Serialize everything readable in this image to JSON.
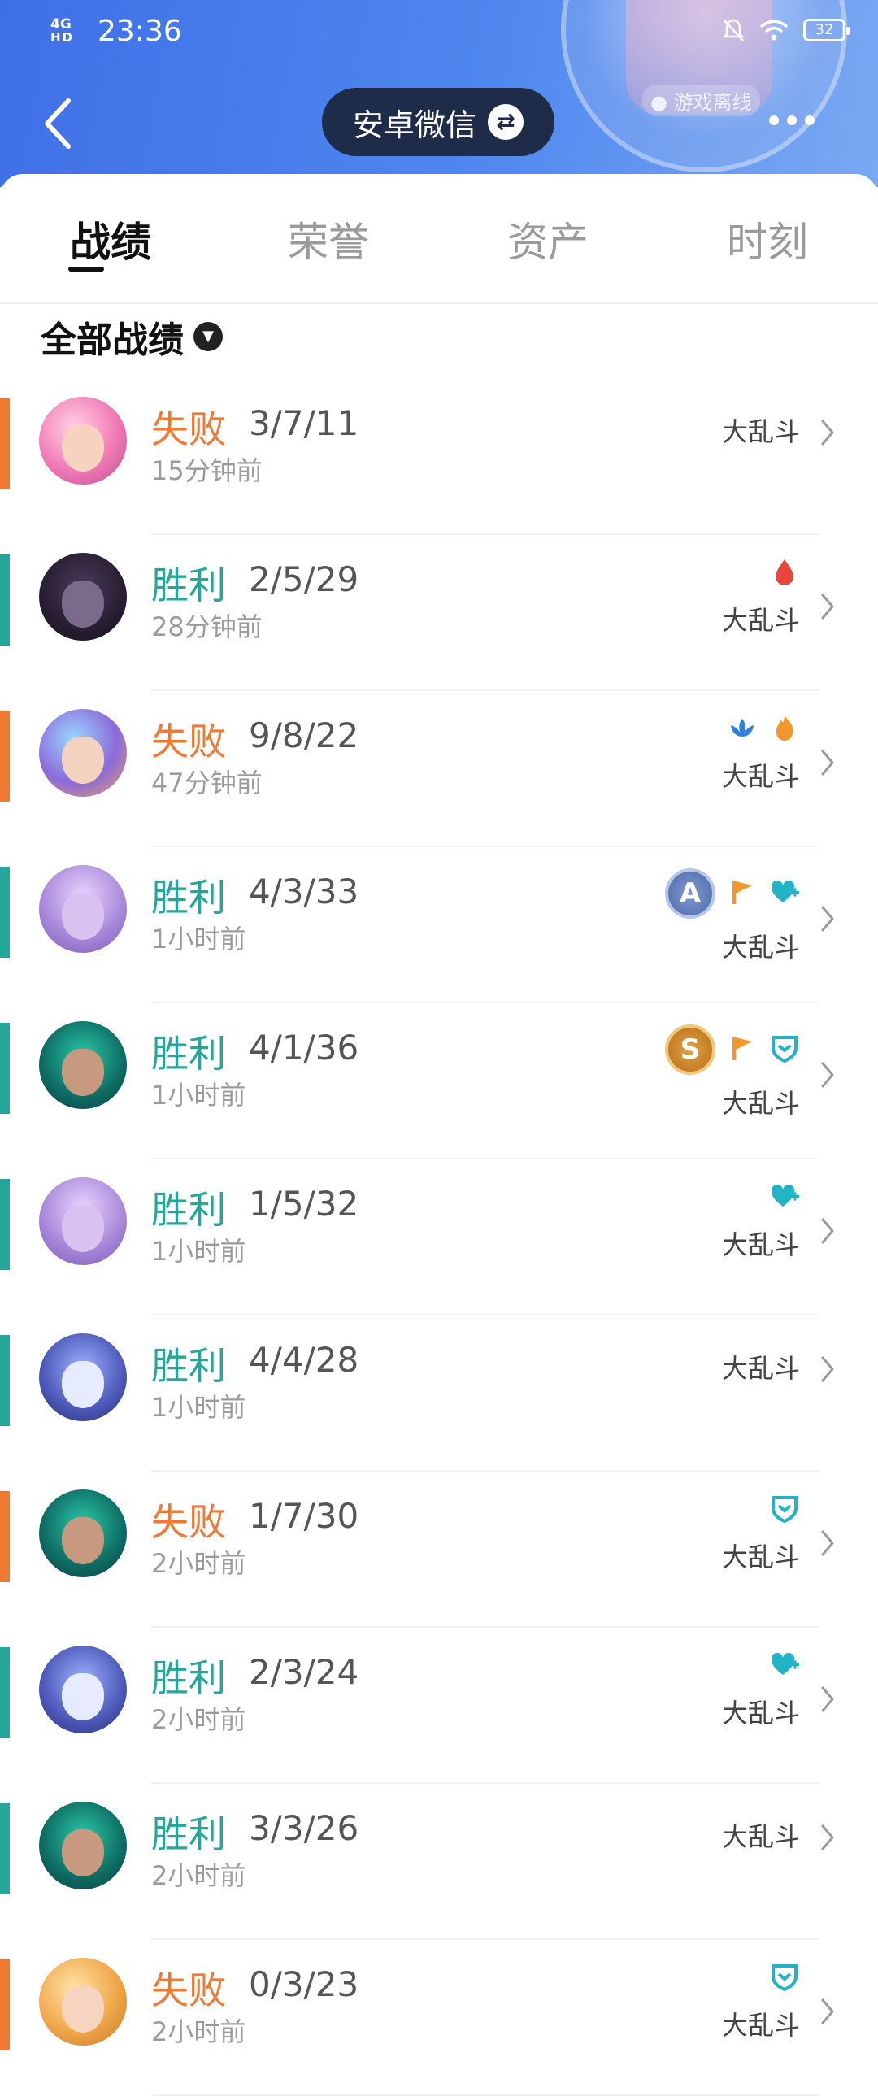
{
  "status_bar": {
    "network": "4G",
    "network_sub": "HD",
    "time": "23:36",
    "battery": "32"
  },
  "header": {
    "account_label": "安卓微信",
    "offline_label": "游戏离线"
  },
  "tabs": [
    {
      "label": "战绩"
    },
    {
      "label": "荣誉"
    },
    {
      "label": "资产"
    },
    {
      "label": "时刻"
    }
  ],
  "filter": {
    "label": "全部战绩"
  },
  "colors": {
    "loss": "#f07a34",
    "win": "#26a69a",
    "accent_header": "#4a7cea"
  },
  "matches": [
    {
      "result": "失败",
      "kda": "3/7/11",
      "time": "15分钟前",
      "mode": "大乱斗",
      "avatar": "pink-hair-champion",
      "badges": []
    },
    {
      "result": "胜利",
      "kda": "2/5/29",
      "time": "28分钟前",
      "mode": "大乱斗",
      "avatar": "dark-purple-champion",
      "badges": [
        "blood-drop-icon"
      ]
    },
    {
      "result": "失败",
      "kda": "9/8/22",
      "time": "47分钟前",
      "mode": "大乱斗",
      "avatar": "pastel-hair-champion",
      "badges": [
        "lotus-icon",
        "flame-icon"
      ]
    },
    {
      "result": "胜利",
      "kda": "4/3/33",
      "time": "1小时前",
      "mode": "大乱斗",
      "avatar": "violet-robed-champion",
      "badges": [
        "A",
        "flag-icon",
        "heart-plus-icon"
      ]
    },
    {
      "result": "胜利",
      "kda": "4/1/36",
      "time": "1小时前",
      "mode": "大乱斗",
      "avatar": "green-gem-champion",
      "badges": [
        "S",
        "flag-icon",
        "shield-icon"
      ]
    },
    {
      "result": "胜利",
      "kda": "1/5/32",
      "time": "1小时前",
      "mode": "大乱斗",
      "avatar": "violet-robed-champion",
      "badges": [
        "heart-plus-icon"
      ]
    },
    {
      "result": "胜利",
      "kda": "4/4/28",
      "time": "1小时前",
      "mode": "大乱斗",
      "avatar": "blue-cat-champion",
      "badges": []
    },
    {
      "result": "失败",
      "kda": "1/7/30",
      "time": "2小时前",
      "mode": "大乱斗",
      "avatar": "green-gem-champion",
      "badges": [
        "shield-icon"
      ]
    },
    {
      "result": "胜利",
      "kda": "2/3/24",
      "time": "2小时前",
      "mode": "大乱斗",
      "avatar": "blue-cat-champion",
      "badges": [
        "heart-plus-icon"
      ]
    },
    {
      "result": "胜利",
      "kda": "3/3/26",
      "time": "2小时前",
      "mode": "大乱斗",
      "avatar": "green-gem-champion",
      "badges": []
    },
    {
      "result": "失败",
      "kda": "0/3/23",
      "time": "2小时前",
      "mode": "大乱斗",
      "avatar": "blonde-champion",
      "badges": [
        "shield-icon"
      ]
    }
  ]
}
